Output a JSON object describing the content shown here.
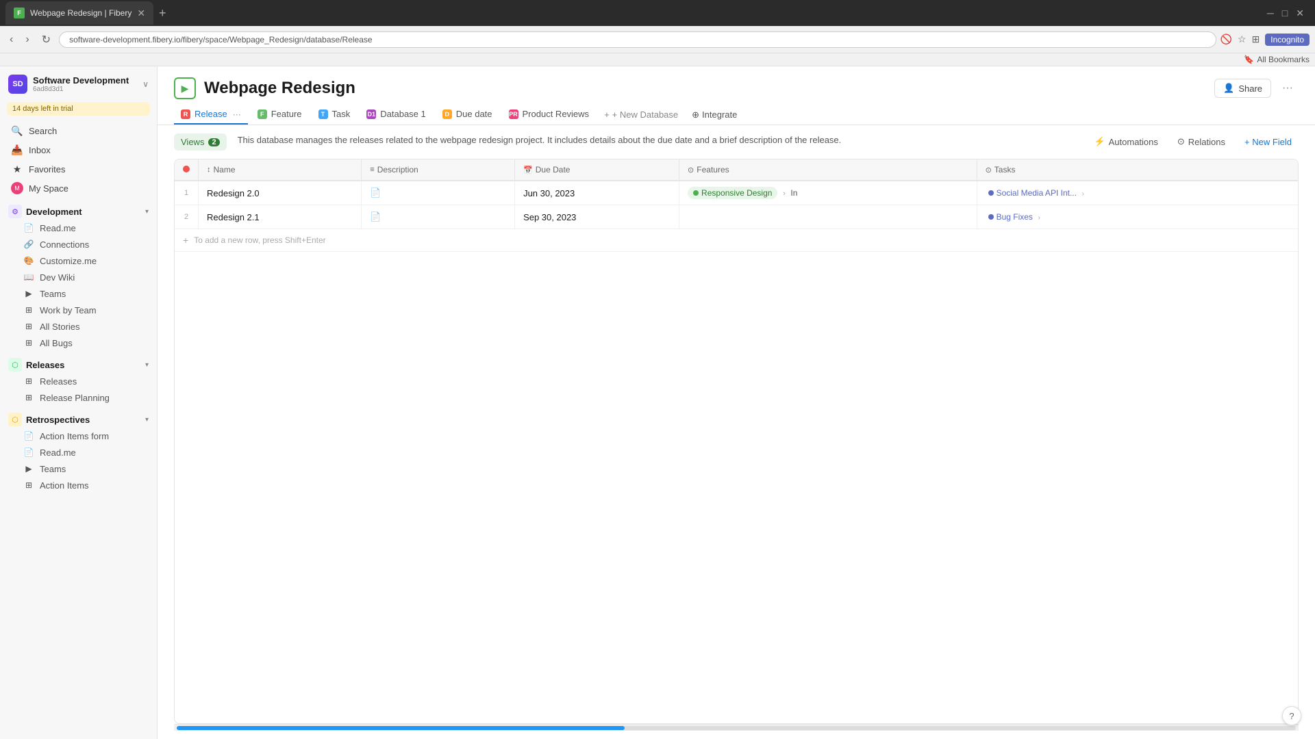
{
  "browser": {
    "tab_title": "Webpage Redesign | Fibery",
    "tab_favicon": "F",
    "address": "software-development.fibery.io/fibery/space/Webpage_Redesign/database/Release",
    "bookmarks_label": "All Bookmarks",
    "incognito_label": "Incognito"
  },
  "workspace": {
    "name": "Software Development",
    "id": "6ad8d3d1",
    "avatar_text": "SD",
    "trial_text": "14 days left in trial"
  },
  "sidebar": {
    "search_label": "Search",
    "inbox_label": "Inbox",
    "favorites_label": "Favorites",
    "my_space_label": "My Space",
    "sections": [
      {
        "name": "Development",
        "icon_color": "#7c3aed",
        "items": [
          "Read.me",
          "Connections",
          "Customize.me",
          "Dev Wiki",
          "Teams",
          "Work by Team",
          "All Stories",
          "All Bugs"
        ]
      },
      {
        "name": "Releases",
        "icon_color": "#22c55e",
        "items": [
          "Releases",
          "Release Planning"
        ]
      },
      {
        "name": "Retrospectives",
        "icon_color": "#f59e0b",
        "items": [
          "Action Items form",
          "Read.me",
          "Teams",
          "Action Items"
        ]
      }
    ]
  },
  "page": {
    "title": "Webpage Redesign",
    "icon_label": "▶",
    "share_label": "Share",
    "description": "This database manages the releases related to the webpage redesign project. It includes details about the due date and a brief description of the release.",
    "views_label": "Views",
    "views_count": "2"
  },
  "tabs": [
    {
      "label": "Release",
      "color": "#ef5350",
      "active": true,
      "has_dots": true
    },
    {
      "label": "Feature",
      "color": "#66bb6a",
      "active": false
    },
    {
      "label": "Task",
      "color": "#42a5f5",
      "active": false
    },
    {
      "label": "Database 1",
      "color": "#ab47bc",
      "active": false
    },
    {
      "label": "Due date",
      "color": "#f59e0b",
      "active": false
    },
    {
      "label": "Product Reviews",
      "color": "#ec407a",
      "active": false
    }
  ],
  "toolbar": {
    "new_database_label": "+ New Database",
    "integrate_label": "Integrate",
    "automations_label": "Automations",
    "relations_label": "Relations",
    "new_field_label": "+ New Field"
  },
  "table": {
    "columns": [
      "",
      "Name",
      "Description",
      "Due Date",
      "Features",
      "Tasks"
    ],
    "rows": [
      {
        "num": "1",
        "name": "Redesign 2.0",
        "description": "📄",
        "due_date": "Jun 30, 2023",
        "features": "Responsive Design",
        "features_arrow": "→",
        "features_extra": "In",
        "tasks": "Social Media API Int...",
        "tasks_arrow": "→"
      },
      {
        "num": "2",
        "name": "Redesign 2.1",
        "description": "📄",
        "due_date": "Sep 30, 2023",
        "features": "",
        "tasks": "Bug Fixes",
        "tasks_arrow": "→"
      }
    ],
    "add_row_hint": "To add a new row, press Shift+Enter"
  }
}
